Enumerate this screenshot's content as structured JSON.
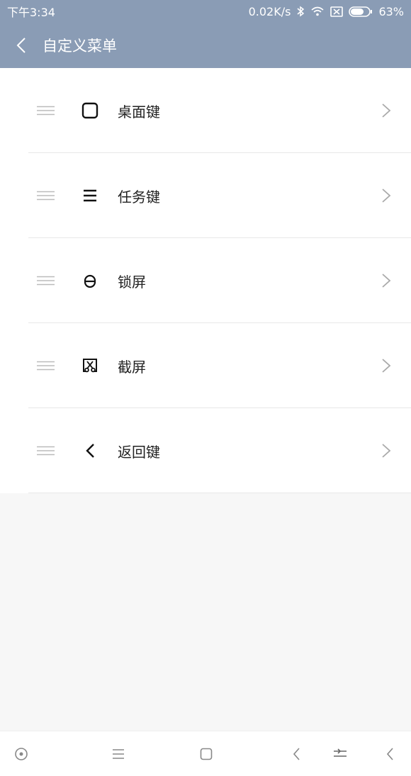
{
  "status_bar": {
    "time": "下午3:34",
    "network_speed": "0.02K/s",
    "battery": "63%",
    "icons": [
      "bluetooth-icon",
      "wifi-icon",
      "sim-icon",
      "battery-icon"
    ]
  },
  "header": {
    "title": "自定义菜单",
    "back_icon": "back-arrow-icon"
  },
  "menu_items": [
    {
      "label": "桌面键",
      "icon": "square-icon"
    },
    {
      "label": "任务键",
      "icon": "hamburger-icon"
    },
    {
      "label": "锁屏",
      "icon": "lock-icon"
    },
    {
      "label": "截屏",
      "icon": "screenshot-scissors-icon"
    },
    {
      "label": "返回键",
      "icon": "back-chevron-icon"
    }
  ],
  "navbar": {
    "icons": [
      "circle-dot-icon",
      "menu-icon",
      "home-square-icon",
      "back-chevron-icon",
      "split-icon",
      "back-chevron-icon"
    ]
  },
  "colors": {
    "header_bg": "#8a9cb5",
    "list_bg": "#ffffff",
    "page_bg": "#f7f7f7"
  }
}
